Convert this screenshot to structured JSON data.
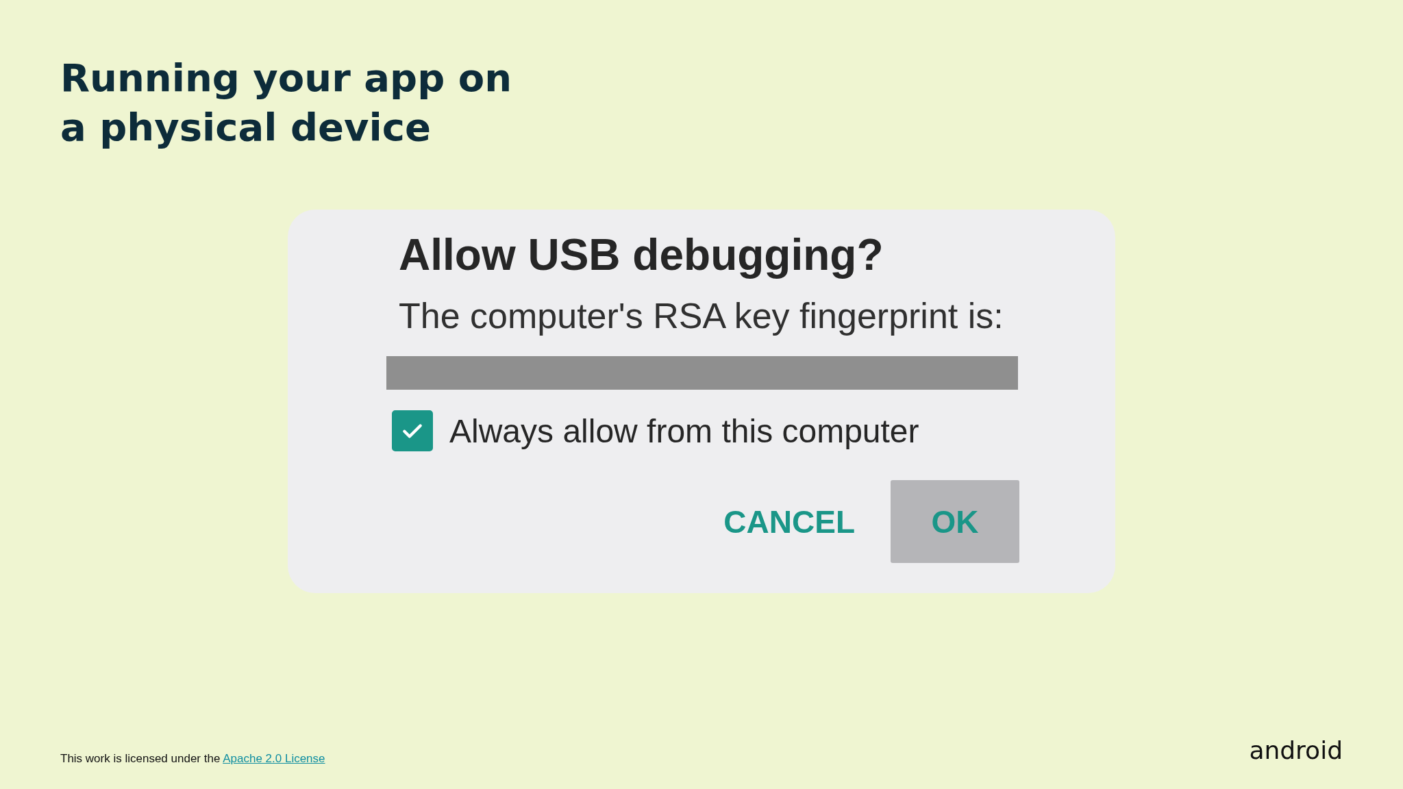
{
  "slide": {
    "title": "Running your app on a physical device"
  },
  "dialog": {
    "title": "Allow USB debugging?",
    "message": "The computer's RSA key fingerprint is:",
    "checkbox": {
      "label": "Always allow from this computer",
      "checked": true
    },
    "buttons": [
      {
        "label": "CANCEL",
        "kind": "text"
      },
      {
        "label": "OK",
        "kind": "filled"
      }
    ]
  },
  "footer": {
    "text": "This work is licensed under the",
    "link": "Apache 2.0 License"
  },
  "logo": {
    "text": "android"
  }
}
